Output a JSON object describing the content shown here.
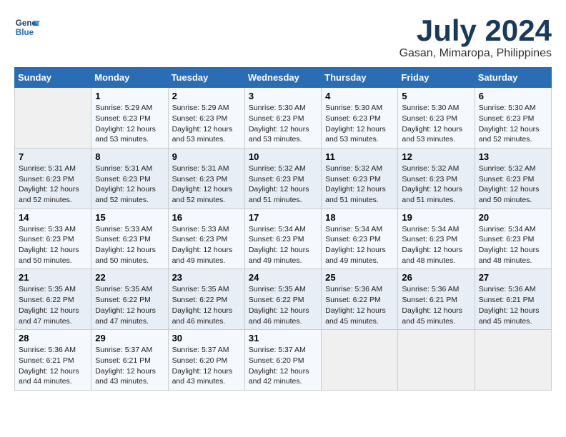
{
  "header": {
    "logo_line1": "General",
    "logo_line2": "Blue",
    "title": "July 2024",
    "subtitle": "Gasan, Mimaropa, Philippines"
  },
  "columns": [
    "Sunday",
    "Monday",
    "Tuesday",
    "Wednesday",
    "Thursday",
    "Friday",
    "Saturday"
  ],
  "weeks": [
    [
      {
        "day": "",
        "sunrise": "",
        "sunset": "",
        "daylight": ""
      },
      {
        "day": "1",
        "sunrise": "Sunrise: 5:29 AM",
        "sunset": "Sunset: 6:23 PM",
        "daylight": "Daylight: 12 hours and 53 minutes."
      },
      {
        "day": "2",
        "sunrise": "Sunrise: 5:29 AM",
        "sunset": "Sunset: 6:23 PM",
        "daylight": "Daylight: 12 hours and 53 minutes."
      },
      {
        "day": "3",
        "sunrise": "Sunrise: 5:30 AM",
        "sunset": "Sunset: 6:23 PM",
        "daylight": "Daylight: 12 hours and 53 minutes."
      },
      {
        "day": "4",
        "sunrise": "Sunrise: 5:30 AM",
        "sunset": "Sunset: 6:23 PM",
        "daylight": "Daylight: 12 hours and 53 minutes."
      },
      {
        "day": "5",
        "sunrise": "Sunrise: 5:30 AM",
        "sunset": "Sunset: 6:23 PM",
        "daylight": "Daylight: 12 hours and 53 minutes."
      },
      {
        "day": "6",
        "sunrise": "Sunrise: 5:30 AM",
        "sunset": "Sunset: 6:23 PM",
        "daylight": "Daylight: 12 hours and 52 minutes."
      }
    ],
    [
      {
        "day": "7",
        "sunrise": "Sunrise: 5:31 AM",
        "sunset": "Sunset: 6:23 PM",
        "daylight": "Daylight: 12 hours and 52 minutes."
      },
      {
        "day": "8",
        "sunrise": "Sunrise: 5:31 AM",
        "sunset": "Sunset: 6:23 PM",
        "daylight": "Daylight: 12 hours and 52 minutes."
      },
      {
        "day": "9",
        "sunrise": "Sunrise: 5:31 AM",
        "sunset": "Sunset: 6:23 PM",
        "daylight": "Daylight: 12 hours and 52 minutes."
      },
      {
        "day": "10",
        "sunrise": "Sunrise: 5:32 AM",
        "sunset": "Sunset: 6:23 PM",
        "daylight": "Daylight: 12 hours and 51 minutes."
      },
      {
        "day": "11",
        "sunrise": "Sunrise: 5:32 AM",
        "sunset": "Sunset: 6:23 PM",
        "daylight": "Daylight: 12 hours and 51 minutes."
      },
      {
        "day": "12",
        "sunrise": "Sunrise: 5:32 AM",
        "sunset": "Sunset: 6:23 PM",
        "daylight": "Daylight: 12 hours and 51 minutes."
      },
      {
        "day": "13",
        "sunrise": "Sunrise: 5:32 AM",
        "sunset": "Sunset: 6:23 PM",
        "daylight": "Daylight: 12 hours and 50 minutes."
      }
    ],
    [
      {
        "day": "14",
        "sunrise": "Sunrise: 5:33 AM",
        "sunset": "Sunset: 6:23 PM",
        "daylight": "Daylight: 12 hours and 50 minutes."
      },
      {
        "day": "15",
        "sunrise": "Sunrise: 5:33 AM",
        "sunset": "Sunset: 6:23 PM",
        "daylight": "Daylight: 12 hours and 50 minutes."
      },
      {
        "day": "16",
        "sunrise": "Sunrise: 5:33 AM",
        "sunset": "Sunset: 6:23 PM",
        "daylight": "Daylight: 12 hours and 49 minutes."
      },
      {
        "day": "17",
        "sunrise": "Sunrise: 5:34 AM",
        "sunset": "Sunset: 6:23 PM",
        "daylight": "Daylight: 12 hours and 49 minutes."
      },
      {
        "day": "18",
        "sunrise": "Sunrise: 5:34 AM",
        "sunset": "Sunset: 6:23 PM",
        "daylight": "Daylight: 12 hours and 49 minutes."
      },
      {
        "day": "19",
        "sunrise": "Sunrise: 5:34 AM",
        "sunset": "Sunset: 6:23 PM",
        "daylight": "Daylight: 12 hours and 48 minutes."
      },
      {
        "day": "20",
        "sunrise": "Sunrise: 5:34 AM",
        "sunset": "Sunset: 6:23 PM",
        "daylight": "Daylight: 12 hours and 48 minutes."
      }
    ],
    [
      {
        "day": "21",
        "sunrise": "Sunrise: 5:35 AM",
        "sunset": "Sunset: 6:22 PM",
        "daylight": "Daylight: 12 hours and 47 minutes."
      },
      {
        "day": "22",
        "sunrise": "Sunrise: 5:35 AM",
        "sunset": "Sunset: 6:22 PM",
        "daylight": "Daylight: 12 hours and 47 minutes."
      },
      {
        "day": "23",
        "sunrise": "Sunrise: 5:35 AM",
        "sunset": "Sunset: 6:22 PM",
        "daylight": "Daylight: 12 hours and 46 minutes."
      },
      {
        "day": "24",
        "sunrise": "Sunrise: 5:35 AM",
        "sunset": "Sunset: 6:22 PM",
        "daylight": "Daylight: 12 hours and 46 minutes."
      },
      {
        "day": "25",
        "sunrise": "Sunrise: 5:36 AM",
        "sunset": "Sunset: 6:22 PM",
        "daylight": "Daylight: 12 hours and 45 minutes."
      },
      {
        "day": "26",
        "sunrise": "Sunrise: 5:36 AM",
        "sunset": "Sunset: 6:21 PM",
        "daylight": "Daylight: 12 hours and 45 minutes."
      },
      {
        "day": "27",
        "sunrise": "Sunrise: 5:36 AM",
        "sunset": "Sunset: 6:21 PM",
        "daylight": "Daylight: 12 hours and 45 minutes."
      }
    ],
    [
      {
        "day": "28",
        "sunrise": "Sunrise: 5:36 AM",
        "sunset": "Sunset: 6:21 PM",
        "daylight": "Daylight: 12 hours and 44 minutes."
      },
      {
        "day": "29",
        "sunrise": "Sunrise: 5:37 AM",
        "sunset": "Sunset: 6:21 PM",
        "daylight": "Daylight: 12 hours and 43 minutes."
      },
      {
        "day": "30",
        "sunrise": "Sunrise: 5:37 AM",
        "sunset": "Sunset: 6:20 PM",
        "daylight": "Daylight: 12 hours and 43 minutes."
      },
      {
        "day": "31",
        "sunrise": "Sunrise: 5:37 AM",
        "sunset": "Sunset: 6:20 PM",
        "daylight": "Daylight: 12 hours and 42 minutes."
      },
      {
        "day": "",
        "sunrise": "",
        "sunset": "",
        "daylight": ""
      },
      {
        "day": "",
        "sunrise": "",
        "sunset": "",
        "daylight": ""
      },
      {
        "day": "",
        "sunrise": "",
        "sunset": "",
        "daylight": ""
      }
    ]
  ]
}
